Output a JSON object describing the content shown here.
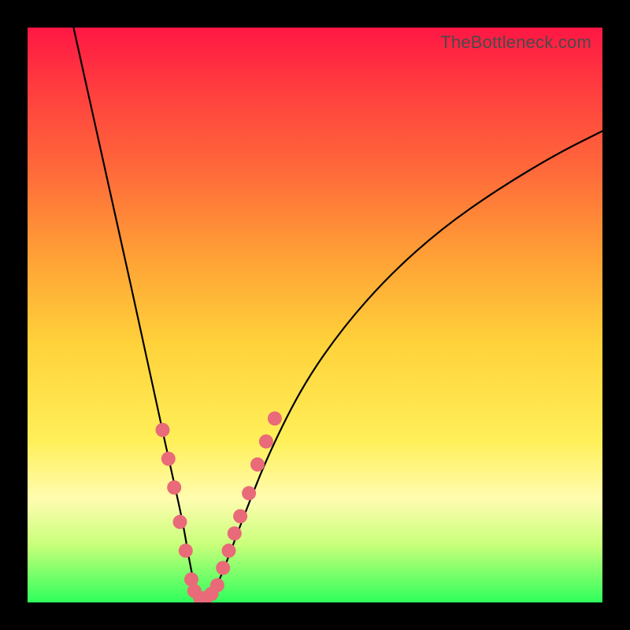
{
  "attribution": "TheBottleneck.com",
  "chart_data": {
    "type": "line",
    "title": "",
    "xlabel": "",
    "ylabel": "",
    "xlim": [
      0,
      100
    ],
    "ylim": [
      0,
      100
    ],
    "note": "V-shaped curve over red→yellow→green vertical gradient; minimum near x≈30 touches bottom (green). Pink dots mark the lower portion of both arms.",
    "series": [
      {
        "name": "curve",
        "x": [
          8,
          12,
          16,
          20,
          23,
          25,
          27,
          28,
          29,
          30,
          31,
          32,
          33,
          35,
          38,
          42,
          48,
          55,
          63,
          72,
          82,
          92,
          100
        ],
        "y": [
          100,
          82,
          64,
          46,
          32,
          23,
          14,
          8,
          3,
          0.5,
          0.5,
          1.5,
          3,
          8,
          16,
          26,
          38,
          48,
          57,
          65,
          72,
          78,
          82
        ]
      }
    ],
    "markers": [
      {
        "x": 23.5,
        "y": 30
      },
      {
        "x": 24.5,
        "y": 25
      },
      {
        "x": 25.5,
        "y": 20
      },
      {
        "x": 26.5,
        "y": 14
      },
      {
        "x": 27.5,
        "y": 9
      },
      {
        "x": 28.5,
        "y": 4
      },
      {
        "x": 29.0,
        "y": 2
      },
      {
        "x": 30.0,
        "y": 0.8
      },
      {
        "x": 31.0,
        "y": 0.8
      },
      {
        "x": 32.0,
        "y": 1.5
      },
      {
        "x": 33.0,
        "y": 3
      },
      {
        "x": 34.0,
        "y": 6
      },
      {
        "x": 35.0,
        "y": 9
      },
      {
        "x": 36.0,
        "y": 12
      },
      {
        "x": 37.0,
        "y": 15
      },
      {
        "x": 38.5,
        "y": 19
      },
      {
        "x": 40.0,
        "y": 24
      },
      {
        "x": 41.5,
        "y": 28
      },
      {
        "x": 43.0,
        "y": 32
      }
    ],
    "colors": {
      "curve": "#000000",
      "markers": "#e96a78",
      "gradient_top": "#ff1744",
      "gradient_bottom": "#2eff5c"
    }
  }
}
